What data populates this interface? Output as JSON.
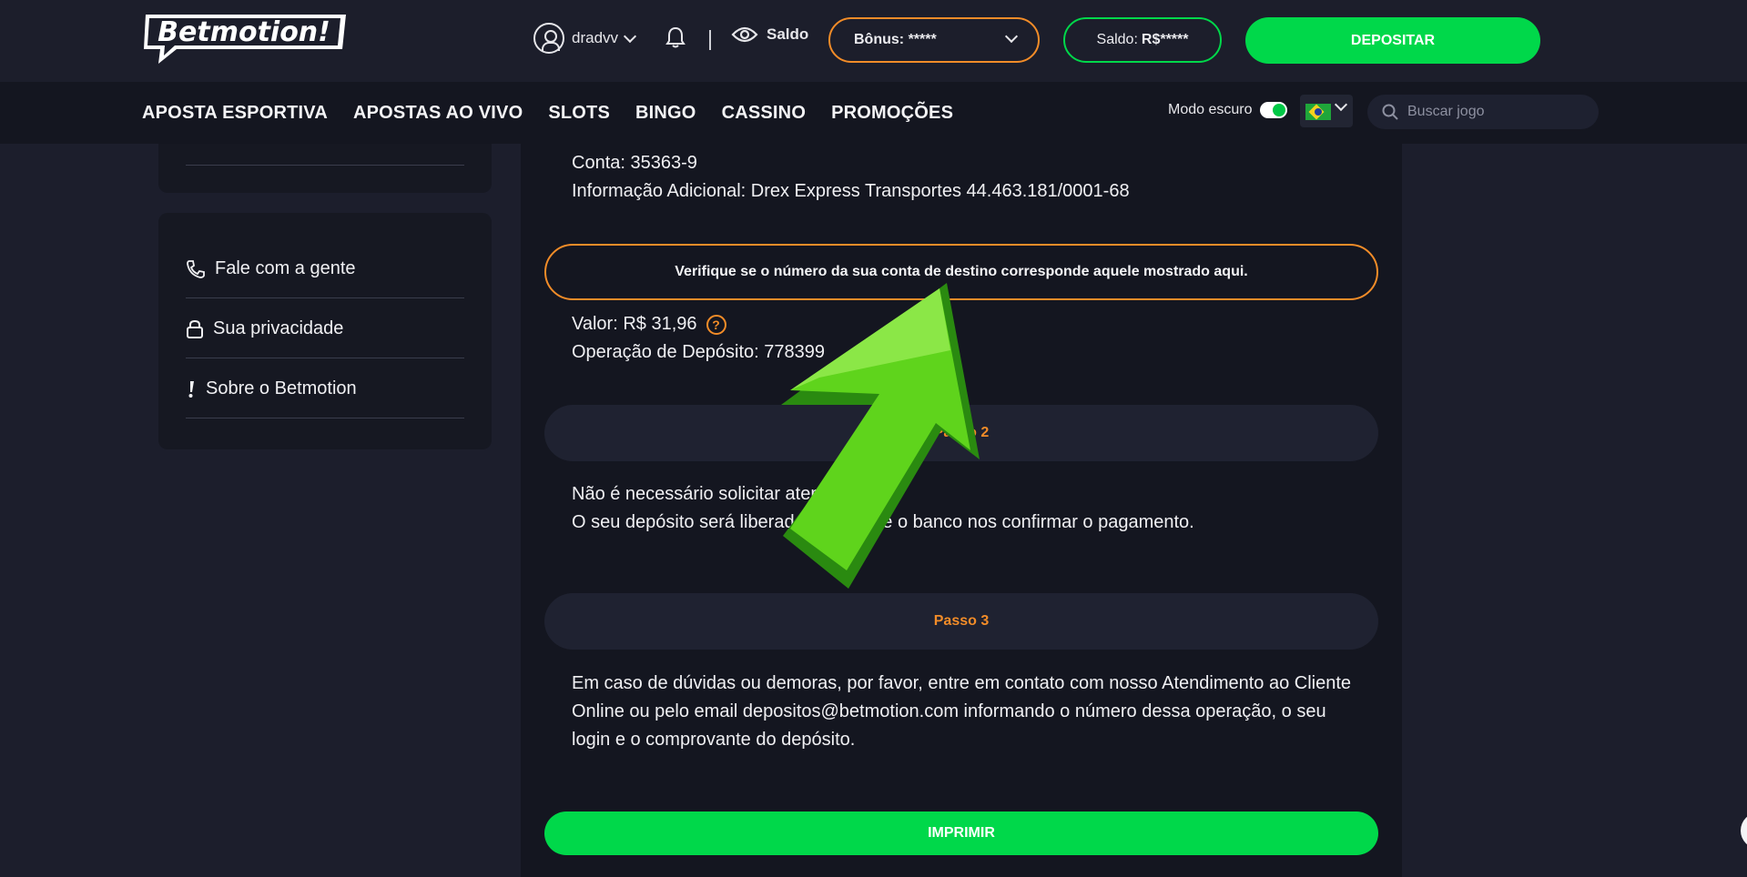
{
  "header": {
    "logo_text": "Betmotion!",
    "username": "dradvv",
    "saldo_toggle_label": "Saldo",
    "bonus_label": "Bônus:",
    "bonus_value": "*****",
    "saldo_label": "Saldo:",
    "saldo_value": "R$*****",
    "deposit_button": "DEPOSITAR"
  },
  "nav": {
    "items": [
      "APOSTA ESPORTIVA",
      "APOSTAS AO VIVO",
      "SLOTS",
      "BINGO",
      "CASSINO",
      "PROMOÇÕES"
    ],
    "dark_mode_label": "Modo escuro",
    "dark_mode_on": true,
    "search_placeholder": "Buscar jogo"
  },
  "sidebar": {
    "items": [
      {
        "label": "Fale com a gente",
        "icon": "phone-icon"
      },
      {
        "label": "Sua privacidade",
        "icon": "lock-icon"
      },
      {
        "label": "Sobre o Betmotion",
        "icon": "exclamation-icon"
      }
    ]
  },
  "main": {
    "account_line": "Conta: 35363-9",
    "additional_info": "Informação Adicional: Drex Express Transportes 44.463.181/0001-68",
    "verify_notice": "Verifique se o número da sua conta de destino corresponde aquele mostrado aqui.",
    "value_line": "Valor: R$ 31,96",
    "operation_line": "Operação de Depósito: 778399",
    "step2_label": "Passo 2",
    "step2_line1": "Não é necessário solicitar atendimento.",
    "step2_line2": "O seu depósito será liberado assim que o banco nos confirmar o pagamento.",
    "step3_label": "Passo 3",
    "step3_line1": "Em caso de dúvidas ou demoras, por favor, entre em contato com nosso Atendimento ao Cliente",
    "step3_line2": "Online ou pelo email depositos@betmotion.com informando o número dessa operação, o seu",
    "step3_line3": "login e o comprovante do depósito.",
    "print_button": "IMPRIMIR"
  },
  "colors": {
    "accent_green": "#00d84a",
    "accent_orange": "#f28c28",
    "background": "#1c1e2c",
    "overlay_arrow": "#5fd41c"
  }
}
